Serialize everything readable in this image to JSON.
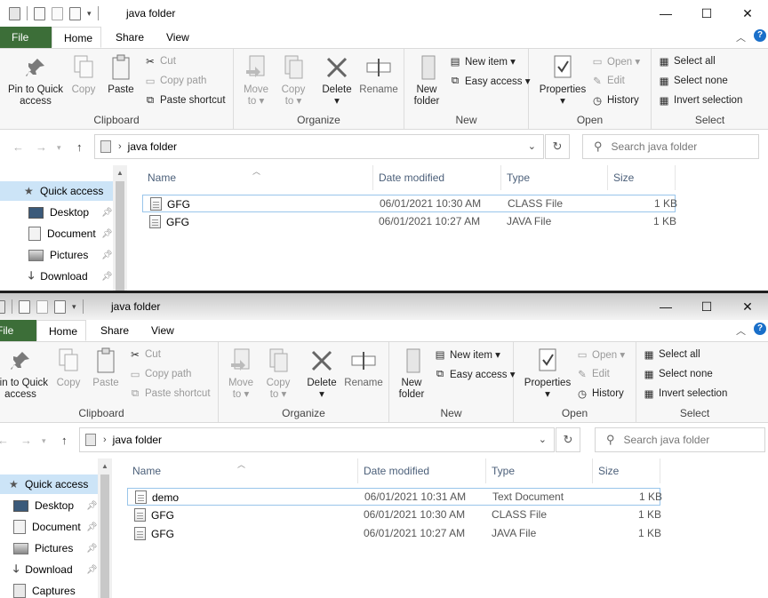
{
  "window_top": {
    "title": "java folder",
    "caption": {
      "minimize": "—",
      "maximize": "☐",
      "close": "✕"
    },
    "tabs": {
      "file": "File",
      "home": "Home",
      "share": "Share",
      "view": "View"
    },
    "ribbon": {
      "pin_to_quick_access": "Pin to Quick\naccess",
      "copy": "Copy",
      "paste": "Paste",
      "cut": "Cut",
      "copy_path": "Copy path",
      "paste_shortcut": "Paste shortcut",
      "group_clipboard": "Clipboard",
      "move_to": "Move\nto ▾",
      "copy_to": "Copy\nto ▾",
      "delete": "Delete\n▾",
      "rename": "Rename",
      "group_organize": "Organize",
      "new_folder": "New\nfolder",
      "new_item": "New item ▾",
      "easy_access": "Easy access ▾",
      "group_new": "New",
      "properties": "Properties\n▾",
      "open": "Open ▾",
      "edit": "Edit",
      "history": "History",
      "group_open": "Open",
      "select_all": "Select all",
      "select_none": "Select none",
      "invert_selection": "Invert selection",
      "group_select": "Select"
    },
    "address": {
      "path": "java folder",
      "search_placeholder": "Search java folder"
    },
    "nav": [
      {
        "label": "Quick access",
        "icon": "star-icon"
      },
      {
        "label": "Desktop",
        "icon": "desktop-icon"
      },
      {
        "label": "Document",
        "icon": "document-icon"
      },
      {
        "label": "Pictures",
        "icon": "pictures-icon"
      },
      {
        "label": "Download",
        "icon": "download-icon"
      }
    ],
    "columns": {
      "name": "Name",
      "date": "Date modified",
      "type": "Type",
      "size": "Size"
    },
    "files": [
      {
        "name": "GFG",
        "date": "06/01/2021 10:30 AM",
        "type": "CLASS File",
        "size": "1 KB"
      },
      {
        "name": "GFG",
        "date": "06/01/2021 10:27 AM",
        "type": "JAVA File",
        "size": "1 KB"
      }
    ]
  },
  "window_bottom": {
    "title": "java folder",
    "caption": {
      "minimize": "—",
      "maximize": "☐",
      "close": "✕"
    },
    "tabs": {
      "file": "File",
      "home": "Home",
      "share": "Share",
      "view": "View"
    },
    "ribbon": {
      "pin_to_quick_access": "Pin to Quick\naccess",
      "copy": "Copy",
      "paste": "Paste",
      "cut": "Cut",
      "copy_path": "Copy path",
      "paste_shortcut": "Paste shortcut",
      "group_clipboard": "Clipboard",
      "move_to": "Move\nto ▾",
      "copy_to": "Copy\nto ▾",
      "delete": "Delete\n▾",
      "rename": "Rename",
      "group_organize": "Organize",
      "new_folder": "New\nfolder",
      "new_item": "New item ▾",
      "easy_access": "Easy access ▾",
      "group_new": "New",
      "properties": "Properties\n▾",
      "open": "Open ▾",
      "edit": "Edit",
      "history": "History",
      "group_open": "Open",
      "select_all": "Select all",
      "select_none": "Select none",
      "invert_selection": "Invert selection",
      "group_select": "Select"
    },
    "address": {
      "path": "java folder",
      "search_placeholder": "Search java folder"
    },
    "nav": [
      {
        "label": "Quick access",
        "icon": "star-icon"
      },
      {
        "label": "Desktop",
        "icon": "desktop-icon"
      },
      {
        "label": "Document",
        "icon": "document-icon"
      },
      {
        "label": "Pictures",
        "icon": "pictures-icon"
      },
      {
        "label": "Download",
        "icon": "download-icon"
      },
      {
        "label": "Captures",
        "icon": "captures-icon"
      }
    ],
    "columns": {
      "name": "Name",
      "date": "Date modified",
      "type": "Type",
      "size": "Size"
    },
    "files": [
      {
        "name": "demo",
        "date": "06/01/2021 10:31 AM",
        "type": "Text Document",
        "size": "1 KB"
      },
      {
        "name": "GFG",
        "date": "06/01/2021 10:30 AM",
        "type": "CLASS File",
        "size": "1 KB"
      },
      {
        "name": "GFG",
        "date": "06/01/2021 10:27 AM",
        "type": "JAVA File",
        "size": "1 KB"
      }
    ]
  }
}
